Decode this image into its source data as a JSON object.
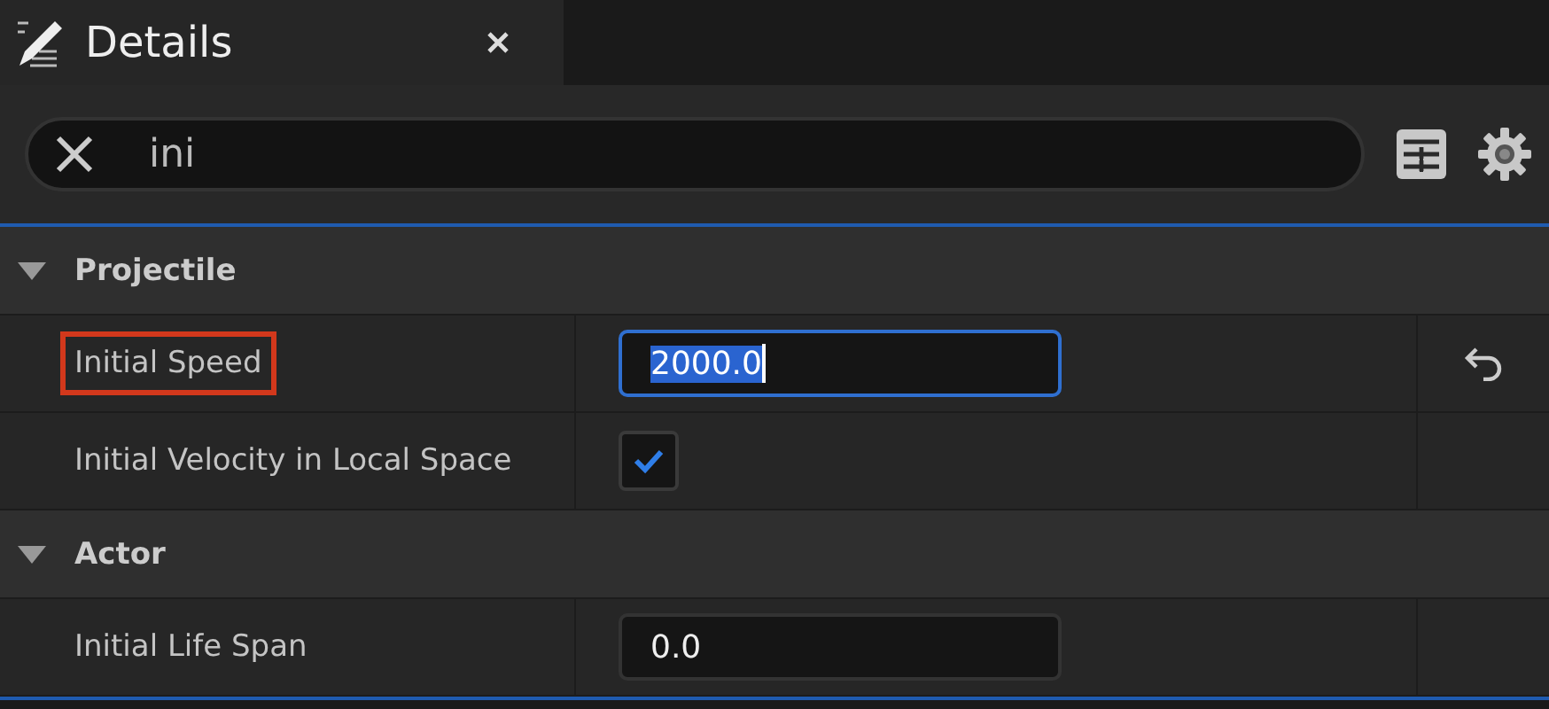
{
  "tab": {
    "title": "Details"
  },
  "search": {
    "value": "ini"
  },
  "sections": [
    {
      "title": "Projectile",
      "expanded": true,
      "rows": [
        {
          "kind": "number",
          "label": "Initial Speed",
          "value": "2000.0",
          "highlighted": true,
          "focused": true,
          "resettable": true
        },
        {
          "kind": "checkbox",
          "label": "Initial Velocity in Local Space",
          "checked": true,
          "highlighted": false,
          "resettable": false
        }
      ]
    },
    {
      "title": "Actor",
      "expanded": true,
      "rows": [
        {
          "kind": "number",
          "label": "Initial Life Span",
          "value": "0.0",
          "highlighted": false,
          "focused": false,
          "resettable": false
        }
      ]
    }
  ]
}
